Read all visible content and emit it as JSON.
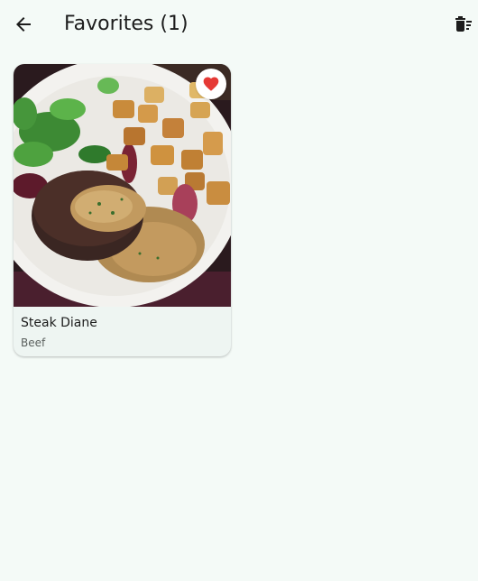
{
  "appbar": {
    "title": "Favorites (1)",
    "back_icon": "arrow-back-icon",
    "clear_icon": "delete-sweep-icon"
  },
  "favorites": [
    {
      "name": "Steak Diane",
      "category": "Beef",
      "favorited": true,
      "favorite_icon": "heart-icon",
      "favorite_color": "#e53935"
    }
  ],
  "colors": {
    "background": "#f4faf7",
    "card": "#eef5f2",
    "text": "#1c1c1c",
    "subtext": "#5a5f5d",
    "accent_red": "#e53935"
  }
}
